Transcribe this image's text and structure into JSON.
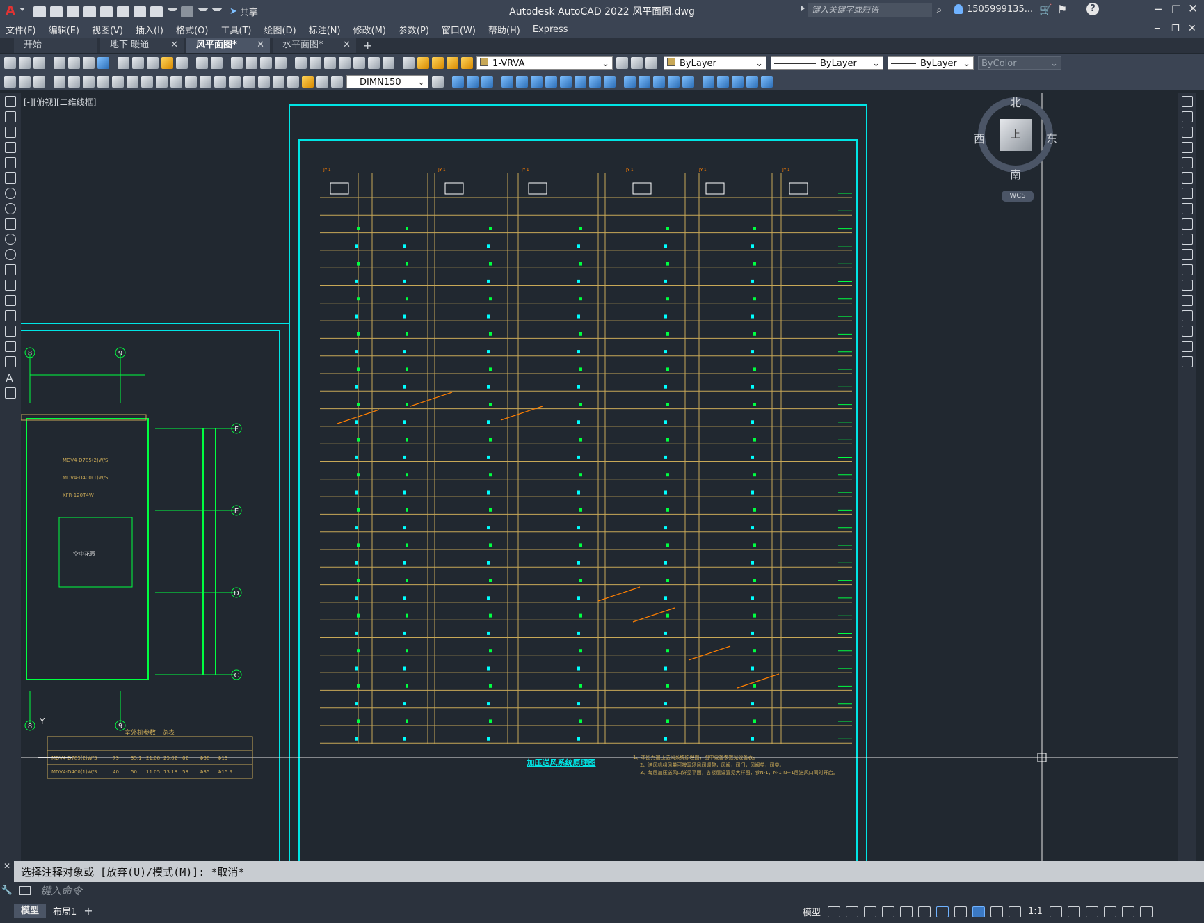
{
  "window": {
    "title": "Autodesk AutoCAD 2022    风平面图.dwg",
    "share": "共享",
    "search_placeholder": "键入关键字或短语",
    "user": "1505999135...",
    "help": "?"
  },
  "menu": [
    "文件(F)",
    "编辑(E)",
    "视图(V)",
    "插入(I)",
    "格式(O)",
    "工具(T)",
    "绘图(D)",
    "标注(N)",
    "修改(M)",
    "参数(P)",
    "窗口(W)",
    "帮助(H)",
    "Express"
  ],
  "tabs": [
    {
      "label": "开始"
    },
    {
      "label": "地下 暖通"
    },
    {
      "label": "风平面图*"
    },
    {
      "label": "水平面图*"
    }
  ],
  "toolbar": {
    "layer": "1-VRVA",
    "color": "ByLayer",
    "linetype": "ByLayer",
    "lineweight": "ByLayer",
    "plotstyle": "ByColor",
    "dimstyle": "DIMN150"
  },
  "viewport": {
    "label": "[-][俯视][二维线框]"
  },
  "viewcube": {
    "north": "北",
    "south": "南",
    "east": "东",
    "west": "西",
    "top": "上",
    "wcs": "WCS"
  },
  "drawing": {
    "diagram_title": "加压送风系统原理图",
    "table_title": "室外机参数一览表",
    "notes": [
      "1、本图为加压送风系统原理图，图中设备参数见设备表。",
      "2、送风机组风量可按现场风阀调整，风阀，阀门，风阀类，阀类。",
      "3、每层加压送风口详见平面，各楼层设置见大样图，参N-1，N-1 N+1层送风口同时开启。"
    ],
    "grid_axes": [
      "F",
      "E",
      "D",
      "C"
    ],
    "column_marks": [
      "8",
      "9",
      "8",
      "9"
    ],
    "equipment": [
      "MDV4-D785(2)W/S",
      "MDV4-D400(1)W/S",
      "KFR-120T4W",
      "空中花园"
    ],
    "table_rows": [
      [
        "MDV4-D785(2)W/S",
        "79",
        "95.1",
        "21.68",
        "25.02",
        "62",
        "Φ38",
        "Φ19"
      ],
      [
        "MDV4-D400(1)W/S",
        "40",
        "50",
        "11.05",
        "13.18",
        "58",
        "Φ35",
        "Φ15.9"
      ]
    ]
  },
  "command": {
    "history": "选择注释对象或 [放弃(U)/模式(M)]: *取消*",
    "placeholder": "键入命令"
  },
  "status": {
    "model_tab": "模型",
    "layout_tab": "布局1",
    "mode": "模型",
    "scale": "1:1"
  },
  "colors": {
    "accent": "#00ffff",
    "drawing_green": "#00ff40",
    "drawing_orange": "#ff7f00",
    "drawing_yellow": "#c8a857"
  }
}
